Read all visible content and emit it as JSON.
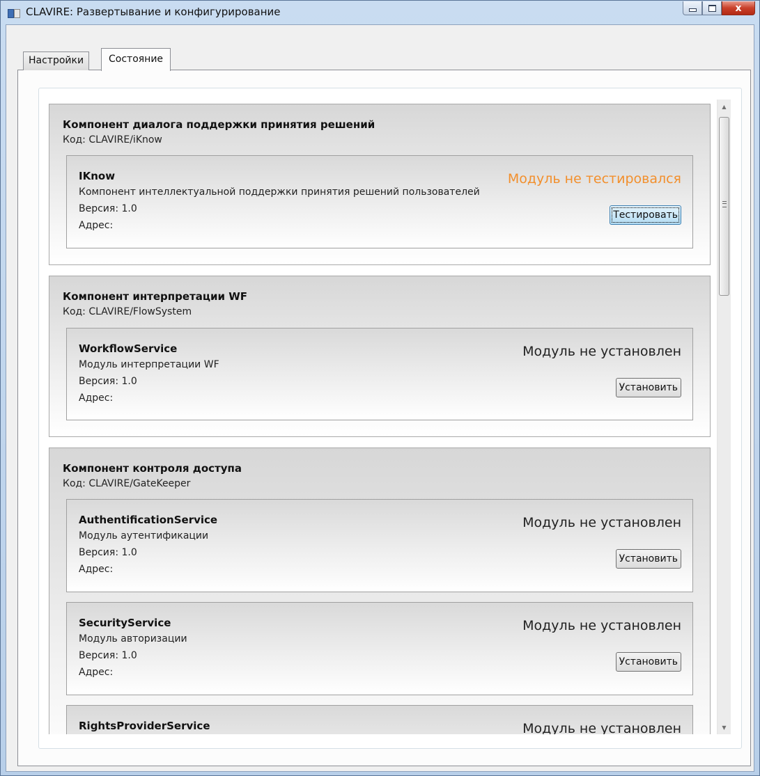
{
  "window": {
    "title": "CLAVIRE: Развертывание и конфигурирование",
    "controls": {
      "minimize": "minimize",
      "maximize": "maximize",
      "close": "x"
    }
  },
  "tabs": [
    {
      "label": "Настройки",
      "selected": false
    },
    {
      "label": "Состояние",
      "selected": true
    }
  ],
  "colors": {
    "status_untested": "#f28f2c",
    "status_not_installed": "#222222"
  },
  "components": [
    {
      "title": "Компонент диалога поддержки принятия решений",
      "code": "Код: CLAVIRE/iKnow",
      "modules": [
        {
          "name": "IKnow",
          "description": "Компонент интеллектуальной поддержки принятия решений пользователей",
          "version": "Версия: 1.0",
          "address": "Адрес:",
          "status": "Модуль не тестировался",
          "button": "Тестировать"
        }
      ]
    },
    {
      "title": "Компонент интерпретации WF",
      "code": "Код: CLAVIRE/FlowSystem",
      "modules": [
        {
          "name": "WorkflowService",
          "description": "Модуль интерпретации WF",
          "version": "Версия: 1.0",
          "address": "Адрес:",
          "status": "Модуль не установлен",
          "button": "Установить"
        }
      ]
    },
    {
      "title": "Компонент контроля доступа",
      "code": "Код: CLAVIRE/GateKeeper",
      "modules": [
        {
          "name": "AuthentificationService",
          "description": "Модуль аутентификации",
          "version": "Версия: 1.0",
          "address": "Адрес:",
          "status": "Модуль не установлен",
          "button": "Установить"
        },
        {
          "name": "SecurityService",
          "description": "Модуль авторизации",
          "version": "Версия: 1.0",
          "address": "Адрес:",
          "status": "Модуль не установлен",
          "button": "Установить"
        },
        {
          "name": "RightsProviderService",
          "status": "Модуль не установлен"
        }
      ]
    }
  ]
}
